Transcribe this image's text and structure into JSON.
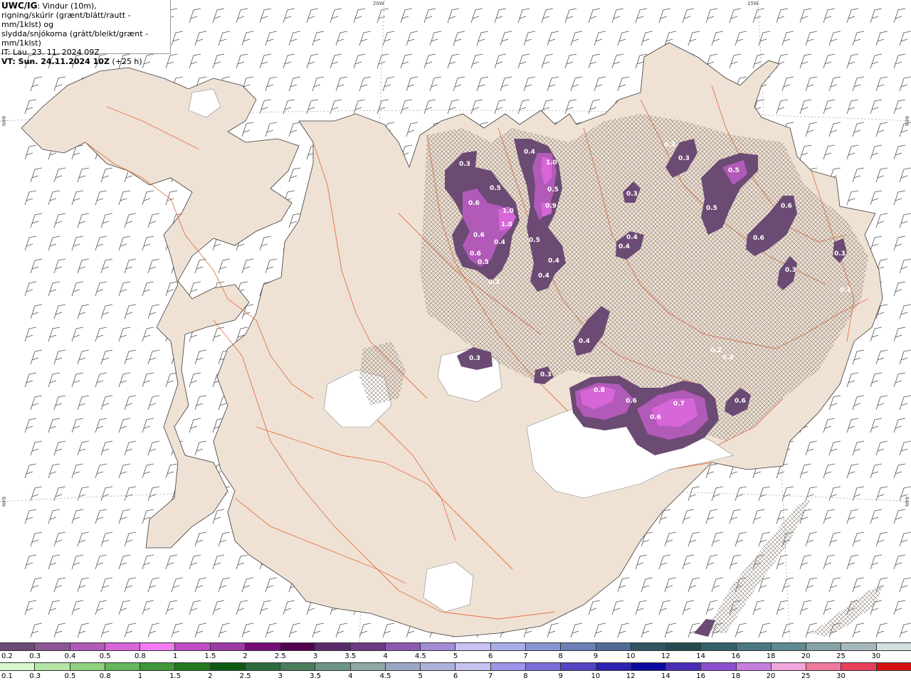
{
  "header": {
    "model": "UWC/IG",
    "line1_rest": ": Vindur (10m),",
    "line2": "rigning/skúrir (grænt/blátt/rautt - mm/1klst) og",
    "line3": "slydda/snjókoma (grátt/bleikt/grænt - mm/1klst)",
    "it": "IT: Lau. 23. 11. 2024 09Z",
    "vt_bold": "VT: Sun. 24.11.2024 10Z",
    "vt_rest": " (+25 h)"
  },
  "coords": {
    "top_20w": "20W",
    "top_15w": "15W",
    "left_66n": "66N",
    "right_66n": "66N",
    "left_64n": "64N",
    "right_64n": "64N"
  },
  "value_labels": [
    "0.3",
    "0.5",
    "0.6",
    "1.0",
    "1.0",
    "0.6",
    "0.4",
    "0.6",
    "0.5",
    "0.3",
    "0.4",
    "1.0",
    "0.5",
    "0.9",
    "0.5",
    "0.4",
    "0.4",
    "0.3",
    "0.3",
    "0.5",
    "0.5",
    "0.3",
    "0.4",
    "0.4",
    "0.6",
    "0.6",
    "0.3",
    "0.4",
    "0.3",
    "0.3",
    "0.3",
    "0.8",
    "0.6",
    "0.7",
    "0.6",
    "0.6",
    "0.2",
    "0.2",
    "0.3"
  ],
  "scale_top": {
    "labels": [
      "0.2",
      "0.3",
      "0.4",
      "0.5",
      "0.8",
      "1",
      "1.5",
      "2",
      "2.5",
      "3",
      "3.5",
      "4",
      "4.5",
      "5",
      "6",
      "7",
      "8",
      "9",
      "10",
      "12",
      "14",
      "16",
      "18",
      "20",
      "25",
      "30"
    ],
    "colors": [
      "#6b4a73",
      "#8c5596",
      "#b15ab8",
      "#d766d9",
      "#f27bf2",
      "#c04cc4",
      "#9c3aa6",
      "#760c7a",
      "#52004f",
      "#5a2b6b",
      "#6e3985",
      "#8b5aaf",
      "#a48bd6",
      "#c8c3f3",
      "#a8aee8",
      "#8a95d4",
      "#6c7fb8",
      "#506c96",
      "#2f5562",
      "#244a50",
      "#34626b",
      "#4a7882",
      "#5e8a93",
      "#86a3a8",
      "#a5b9bb",
      "#d4dfdf"
    ]
  },
  "scale_bottom": {
    "labels": [
      "0.1",
      "0.3",
      "0.5",
      "0.8",
      "1",
      "1.5",
      "2",
      "2.5",
      "3",
      "3.5",
      "4",
      "4.5",
      "5",
      "6",
      "7",
      "8",
      "9",
      "10",
      "12",
      "14",
      "16",
      "18",
      "20",
      "25",
      "30"
    ],
    "colors": [
      "#d9f7d0",
      "#b4e6a6",
      "#8ed17f",
      "#64b85b",
      "#3c9838",
      "#1f7a1e",
      "#0d5a10",
      "#2c6b3e",
      "#4a7e5d",
      "#6d9586",
      "#8fa8a8",
      "#9aa8c6",
      "#aab2dc",
      "#c6c3f0",
      "#9d95e8",
      "#7a6ed8",
      "#5245c4",
      "#2c23b5",
      "#0c0a9e",
      "#4a2cb8",
      "#8c4fd0",
      "#c77ee0",
      "#f0a6dc",
      "#f07a9c",
      "#e8405a",
      "#d61010"
    ]
  }
}
